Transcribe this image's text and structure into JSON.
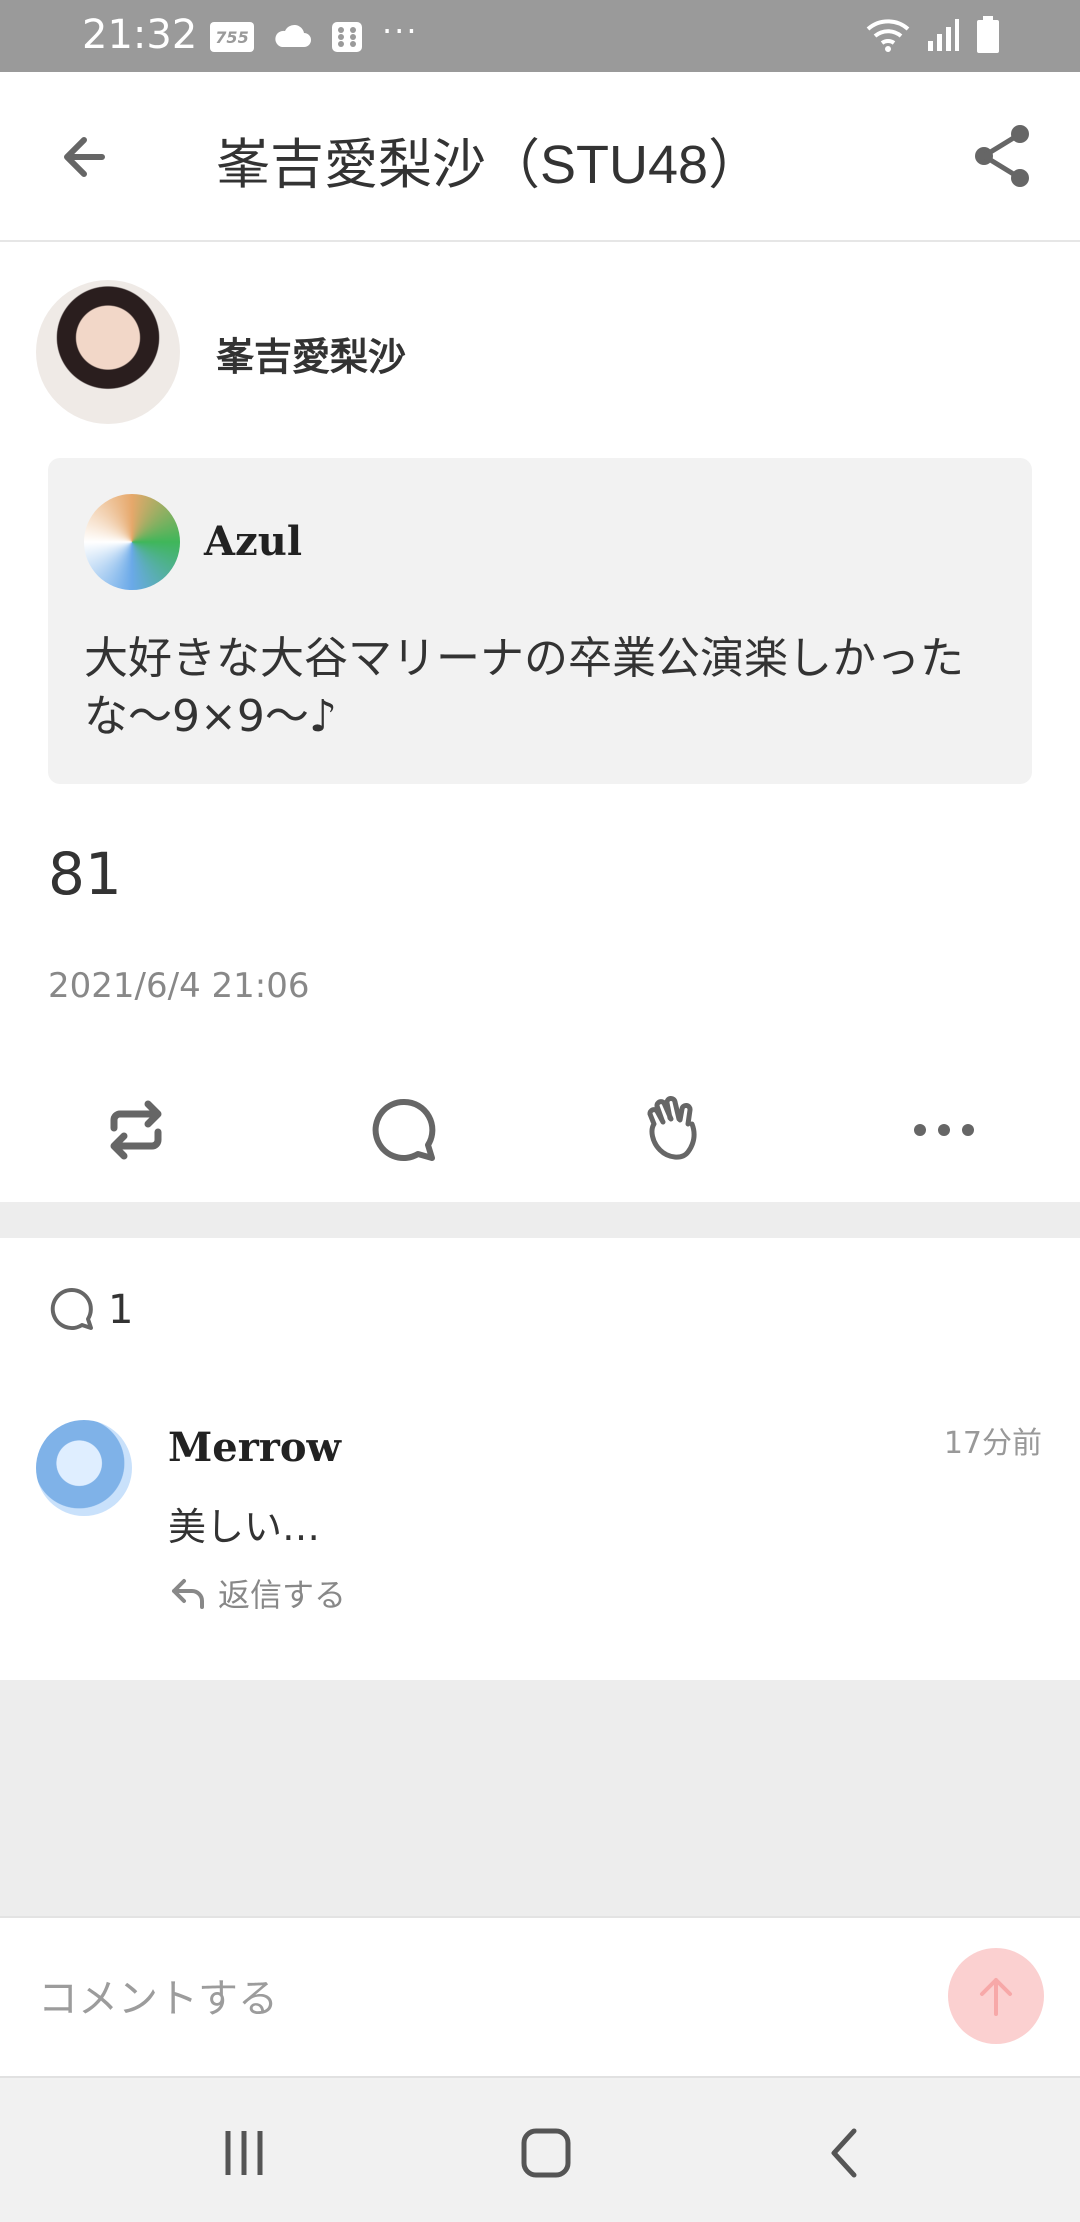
{
  "status_bar": {
    "time": "21:32",
    "badge_text": "755",
    "more_dots": "···",
    "icons": [
      "cloud-icon",
      "dice-icon",
      "wifi-icon",
      "signal-icon",
      "battery-icon"
    ]
  },
  "header": {
    "title": "峯吉愛梨沙（STU48）",
    "back_icon": "arrow-left-icon",
    "share_icon": "share-icon"
  },
  "post": {
    "author": "峯吉愛梨沙",
    "quote": {
      "user": "Azul",
      "text": "大好きな大谷マリーナの卒業公演楽しかったな〜9×9〜♪"
    },
    "number": "81",
    "date": "2021/6/4 21:06",
    "actions": [
      "repost-icon",
      "comment-icon",
      "clap-icon",
      "more-icon"
    ]
  },
  "comments": {
    "count": "1",
    "items": [
      {
        "user": "Merrow",
        "time": "17分前",
        "text": "美しい…",
        "reply_label": "返信する"
      }
    ]
  },
  "comment_input": {
    "placeholder": "コメントする"
  },
  "colors": {
    "status_bar": "#9a9a9a",
    "send_button": "#fbd0d0",
    "separator": "#ededed"
  }
}
